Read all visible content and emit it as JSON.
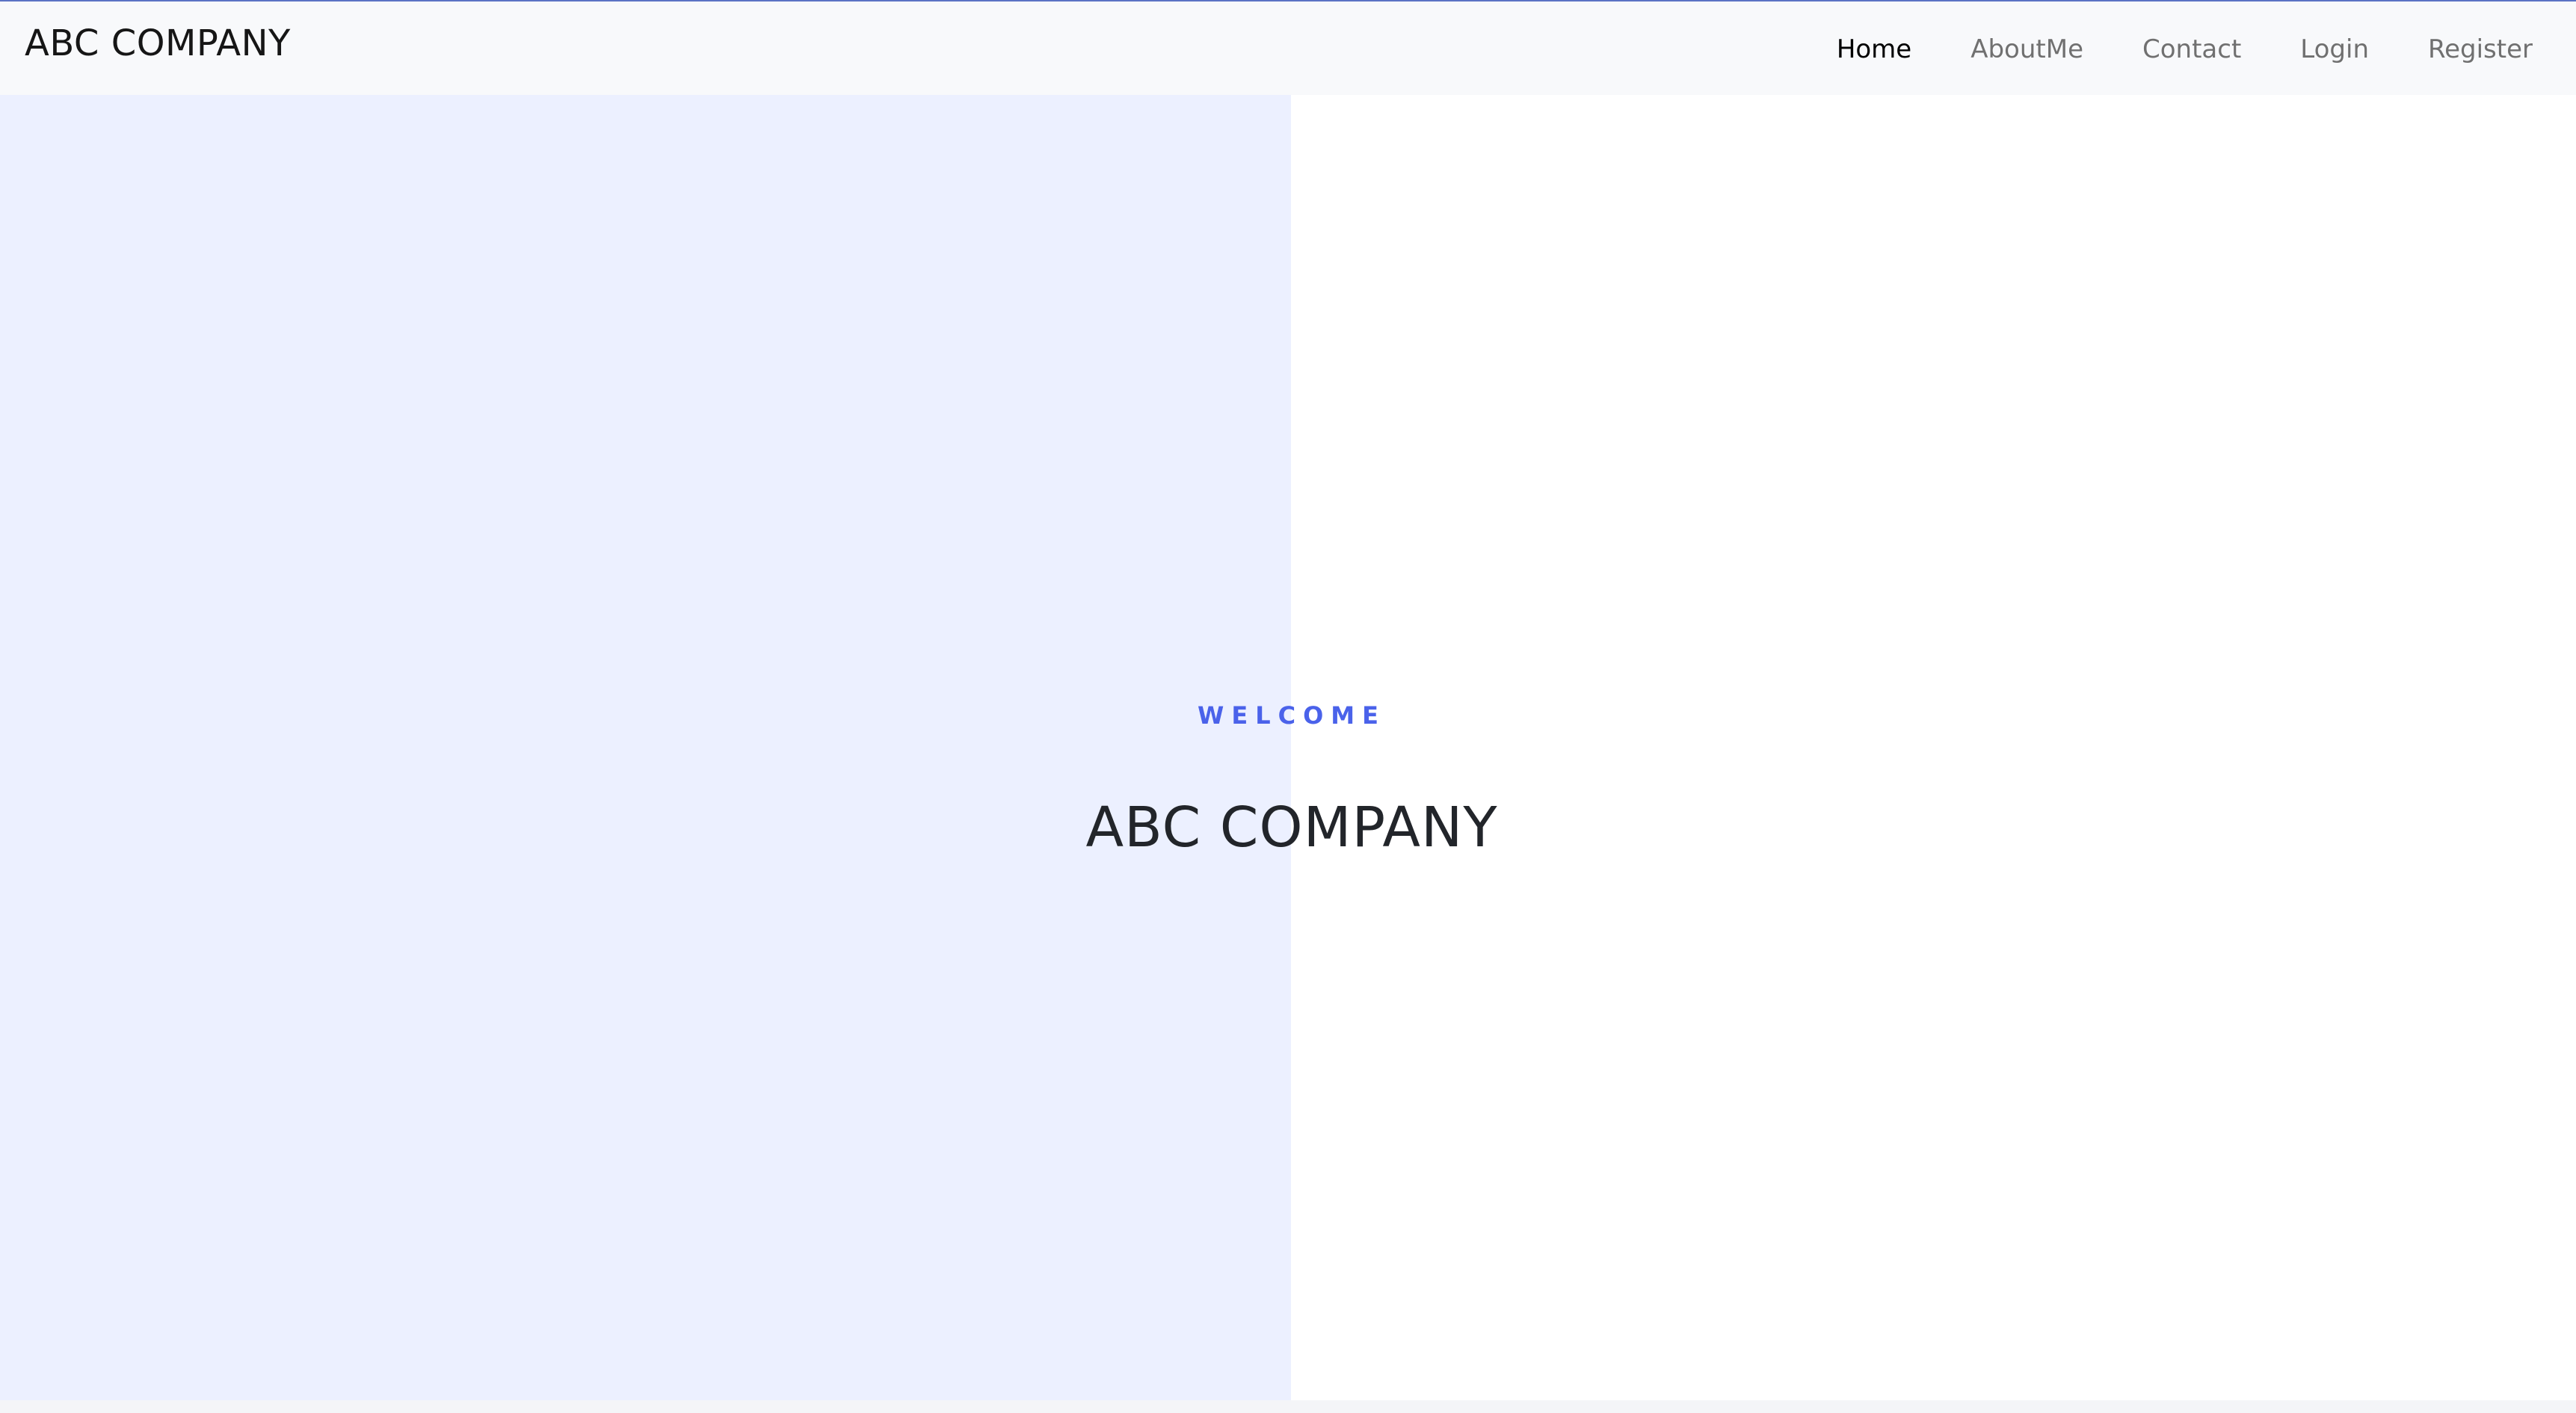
{
  "navbar": {
    "brand": "ABC COMPANY",
    "links": [
      {
        "label": "Home",
        "active": true
      },
      {
        "label": "AboutMe",
        "active": false
      },
      {
        "label": "Contact",
        "active": false
      },
      {
        "label": "Login",
        "active": false
      },
      {
        "label": "Register",
        "active": false
      }
    ]
  },
  "hero": {
    "eyebrow": "WELCOME",
    "title": "ABC COMPANY"
  },
  "colors": {
    "accent": "#4a62ea",
    "left_panel": "#ecf0ff",
    "navbar_bg": "#f8f9fb",
    "nav_link": "#707070",
    "nav_link_active": "#000000"
  }
}
